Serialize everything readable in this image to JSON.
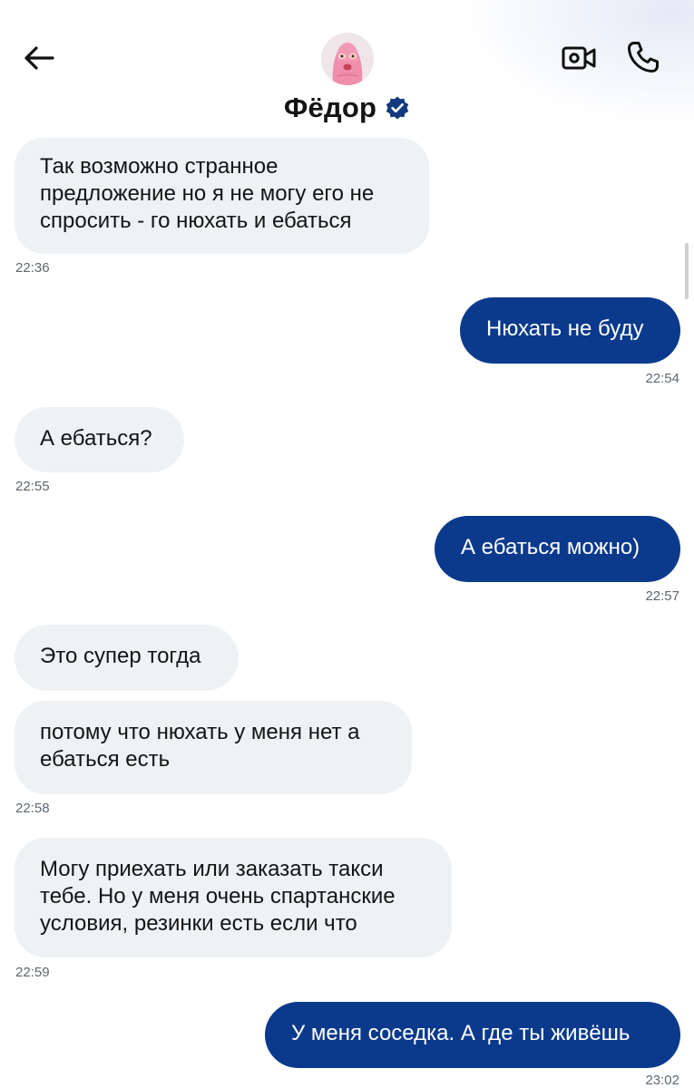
{
  "header": {
    "contact_name": "Фёдор",
    "avatar_description": "pink balaclava avatar",
    "back_icon": "arrow-left-icon",
    "verified_icon": "verified-badge-icon",
    "video_icon": "video-camera-icon",
    "call_icon": "phone-icon"
  },
  "colors": {
    "outgoing_bubble": "#0b3a8c",
    "incoming_bubble": "#eff2f4",
    "verified_badge": "#123a7d"
  },
  "messages": [
    {
      "direction": "in",
      "text": "Так возможно странное предложение но я не могу его не спросить - го нюхать и ебаться",
      "time": "22:36"
    },
    {
      "direction": "out",
      "text": "Нюхать не буду",
      "time": "22:54"
    },
    {
      "direction": "in",
      "text": "А ебаться?",
      "time": "22:55"
    },
    {
      "direction": "out",
      "text": "А ебаться можно)",
      "time": "22:57"
    },
    {
      "direction": "in",
      "text": "Это супер тогда",
      "time": ""
    },
    {
      "direction": "in",
      "text": "потому что нюхать у меня нет а ебаться есть",
      "time": "22:58"
    },
    {
      "direction": "in",
      "text": "Могу приехать или заказать такси тебе. Но у меня очень спартанские условия, резинки есть если что",
      "time": "22:59"
    },
    {
      "direction": "out",
      "text": "У меня соседка. А где ты живёшь",
      "time": "23:02"
    }
  ]
}
